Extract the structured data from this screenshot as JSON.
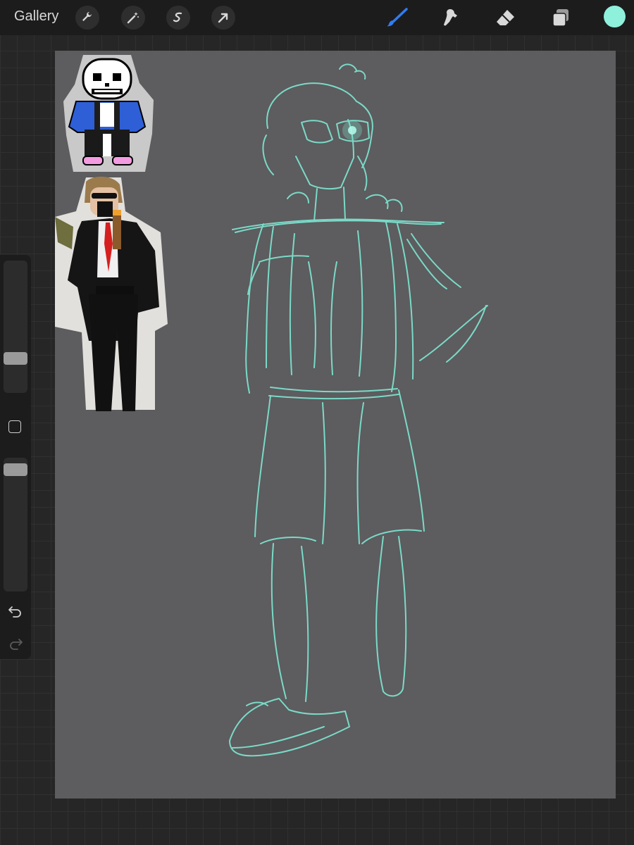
{
  "app": {
    "gallery_label": "Gallery"
  },
  "toolbar": {
    "left_tools": [
      "wrench-icon",
      "magic-wand-icon",
      "selection-icon",
      "transform-arrow-icon"
    ],
    "right_tools": [
      "brush-icon",
      "smudge-icon",
      "eraser-icon",
      "layers-icon"
    ],
    "active_tool": "brush-icon",
    "active_tool_color": "#2f7cf6",
    "current_color": "#8ff0dc"
  },
  "sidebar": {
    "brush_size": 0.26,
    "opacity": 0.98
  },
  "colors": {
    "sketch_stroke": "#7ee8d4",
    "canvas_bg": "#5d5c5e"
  }
}
